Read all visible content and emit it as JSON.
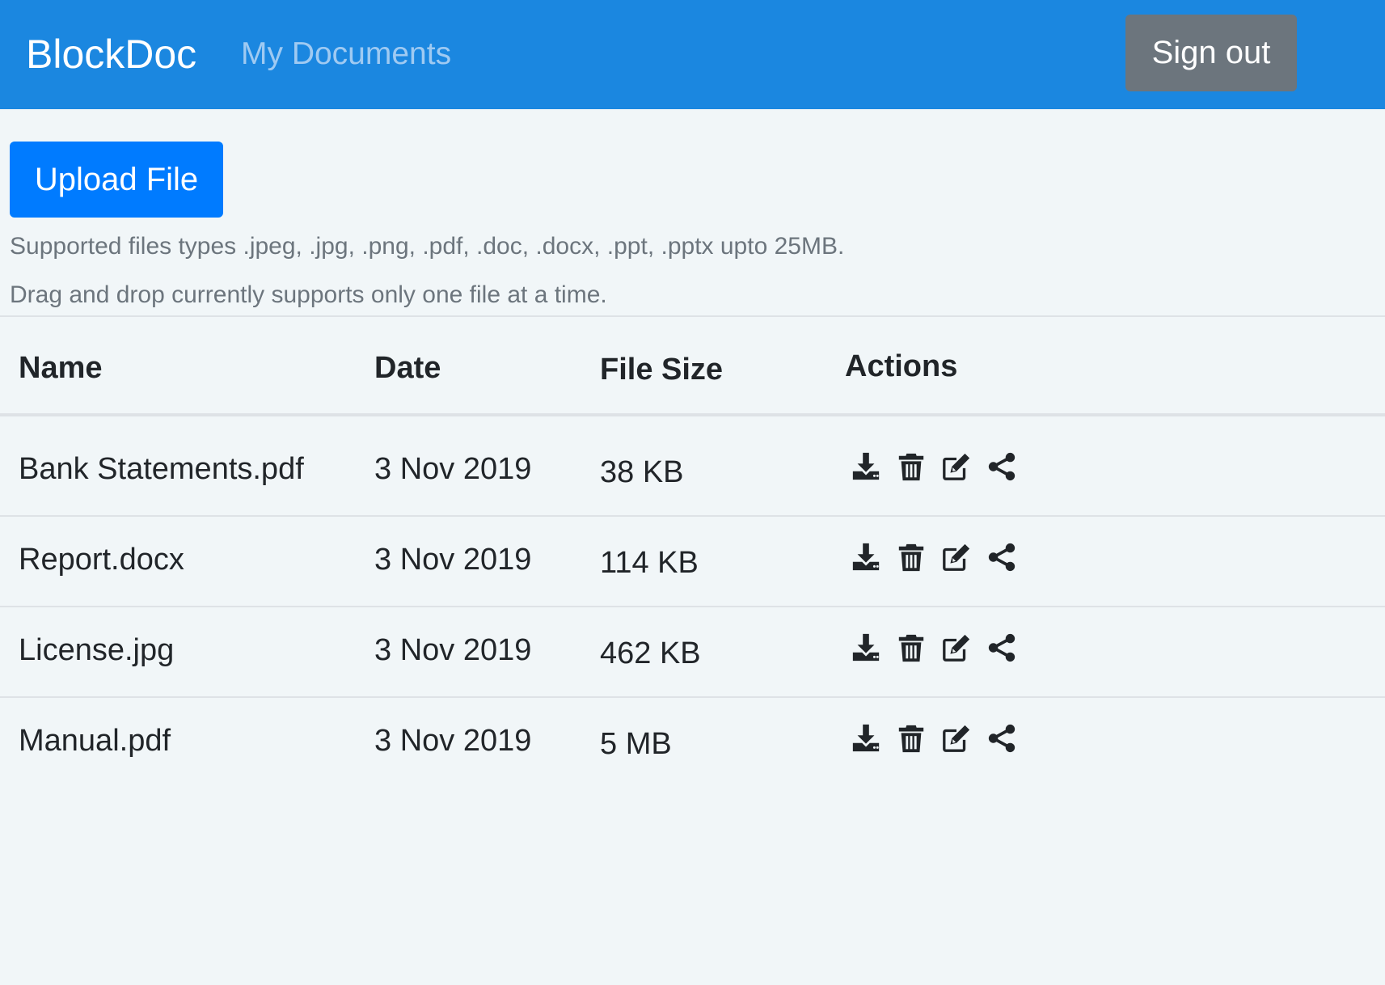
{
  "navbar": {
    "brand": "BlockDoc",
    "link": "My Documents",
    "signout_label": "Sign out"
  },
  "upload": {
    "button_label": "Upload File",
    "hint_types": "Supported files types .jpeg, .jpg, .png, .pdf, .doc, .docx, .ppt, .pptx upto 25MB.",
    "hint_dragdrop": "Drag and drop currently supports only one file at a time."
  },
  "table": {
    "headers": {
      "name": "Name",
      "date": "Date",
      "size": "File Size",
      "actions": "Actions"
    },
    "rows": [
      {
        "name": "Bank Statements.pdf",
        "date": "3 Nov 2019",
        "size": "38 KB"
      },
      {
        "name": "Report.docx",
        "date": "3 Nov 2019",
        "size": "114 KB"
      },
      {
        "name": "License.jpg",
        "date": "3 Nov 2019",
        "size": "462 KB"
      },
      {
        "name": "Manual.pdf",
        "date": "3 Nov 2019",
        "size": "5 MB"
      }
    ],
    "action_icons": [
      "download-icon",
      "trash-icon",
      "edit-icon",
      "share-icon"
    ]
  },
  "colors": {
    "navbar": "#1b87e0",
    "primary": "#007bff",
    "secondary": "#6c757d",
    "background": "#f1f6f8"
  }
}
